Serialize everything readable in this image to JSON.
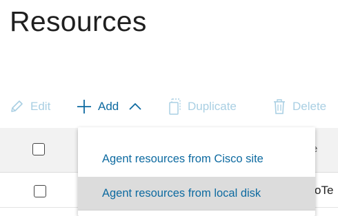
{
  "page": {
    "title": "Resources"
  },
  "toolbar": {
    "edit_label": "Edit",
    "add_label": "Add",
    "duplicate_label": "Duplicate",
    "delete_label": "Delete",
    "icons": {
      "edit": "pencil-icon",
      "add": "plus-icon",
      "add_toggle": "chevron-up-icon",
      "duplicate": "copy-icon",
      "delete": "trash-icon"
    }
  },
  "add_menu": {
    "items": [
      {
        "label": "Agent resources from Cisco site"
      },
      {
        "label": "Agent resources from local disk"
      }
    ]
  },
  "table": {
    "header_peek": "e",
    "row_peek": "oTe"
  },
  "colors": {
    "accent": "#0d6aa0",
    "disabled": "#a9cfe3",
    "header_bg": "#f2f2f2",
    "hover_bg": "#dcdcdc"
  }
}
